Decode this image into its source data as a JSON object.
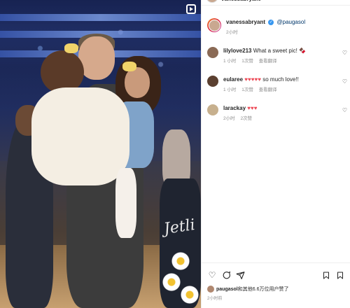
{
  "post": {
    "author": "vanessabryant",
    "mention": "@paugasol",
    "caption_time": "2小时"
  },
  "top_bar": {
    "author": "vanessabryant"
  },
  "photo": {
    "jacket_text": "Jetli"
  },
  "comments": [
    {
      "user": "lilylove213",
      "text": "What a sweet pic!",
      "emoji": "🍫",
      "time": "1 小时",
      "likes": "1次赞",
      "reply": "查看翻译"
    },
    {
      "user": "eularee",
      "hearts": "♥♥♥♥♥",
      "text": "so much love!!",
      "time": "1 小时",
      "likes": "1次赞",
      "reply": "查看翻译"
    },
    {
      "user": "larackay",
      "hearts": "♥♥♥",
      "text": "",
      "time": "2小时",
      "likes": "2次赞",
      "reply": ""
    }
  ],
  "actions": {
    "liked_by_user": "paugasol",
    "liked_by_text": "和其他6.6万位用户赞了",
    "time": "2小时前"
  },
  "colors": {
    "verified": "#3897f0",
    "heart": "#ed4956",
    "link": "#00376b"
  }
}
